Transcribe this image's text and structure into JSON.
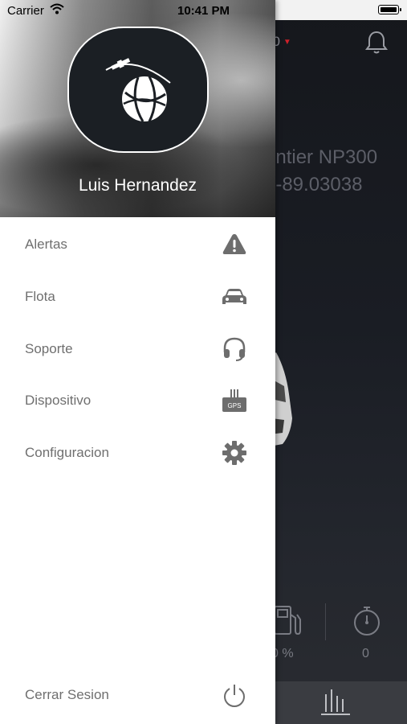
{
  "status_bar": {
    "carrier": "Carrier",
    "time": "10:41 PM"
  },
  "main": {
    "price_text": "00",
    "vehicle_name": "ontier NP300",
    "vehicle_coord": ": -89.03038",
    "fuel_value": "0 %",
    "timer_value": "0"
  },
  "drawer": {
    "user_name": "Luis Hernandez",
    "menu": [
      {
        "label": "Alertas",
        "icon": "warning-icon"
      },
      {
        "label": "Flota",
        "icon": "car-icon"
      },
      {
        "label": "Soporte",
        "icon": "headset-icon"
      },
      {
        "label": "Dispositivo",
        "icon": "gps-device-icon"
      },
      {
        "label": "Configuracion",
        "icon": "gear-icon"
      }
    ],
    "logout_label": "Cerrar Sesion",
    "gps_badge": "GPS"
  },
  "colors": {
    "accent_red": "#d0202a",
    "menu_text": "#6f6f6f",
    "icon_gray": "#6d6d6d"
  }
}
